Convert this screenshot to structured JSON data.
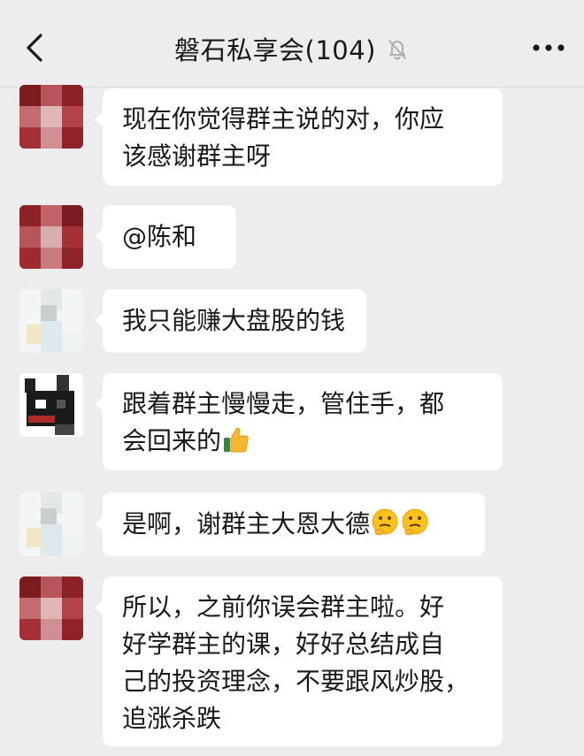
{
  "header": {
    "title": "磐石私享会(104)",
    "back_icon": "chevron-left-icon",
    "mute_icon": "bell-off-icon",
    "more_icon": "more-dots-icon"
  },
  "messages": [
    {
      "avatar": "avatar-red-pixelated",
      "lines": [
        "现在你觉得群主说的对，你应",
        "该感谢群主呀"
      ]
    },
    {
      "avatar": "avatar-red-pixelated",
      "lines": [
        "@陈和"
      ]
    },
    {
      "avatar": "avatar-white-pixelated",
      "lines": [
        "我只能赚大盘股的钱"
      ]
    },
    {
      "avatar": "avatar-black-cat-pixelated",
      "lines": [
        "跟着群主慢慢走，管住手，都",
        "会回来的"
      ],
      "trailing_emoji": "thumbs-up-emoji"
    },
    {
      "avatar": "avatar-white-pixelated",
      "lines": [
        "是啊，谢群主大恩大德"
      ],
      "trailing_emoji": "thinking-face-emoji-x2"
    },
    {
      "avatar": "avatar-red-pixelated",
      "lines": [
        "所以，之前你误会群主啦。好",
        "好学群主的课，好好总结成自",
        "己的投资理念，不要跟风炒股，",
        "追涨杀跌"
      ]
    }
  ],
  "colors": {
    "background": "#ededed",
    "bubble": "#ffffff",
    "text": "#191919"
  }
}
